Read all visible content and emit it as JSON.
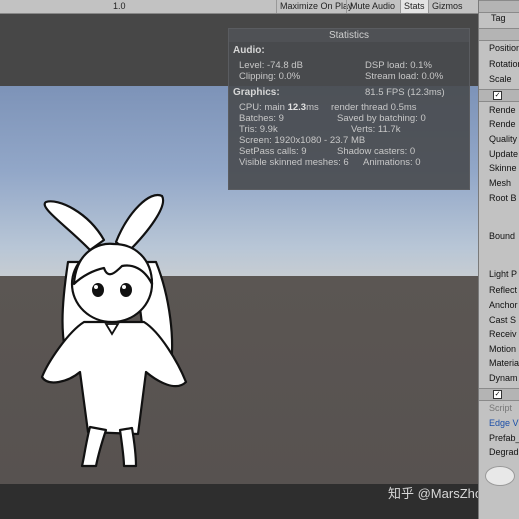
{
  "toolbar": {
    "items": [
      "1.0",
      "Maximize On Play",
      "Mute Audio",
      "Stats",
      "Gizmos"
    ]
  },
  "stats": {
    "title": "Statistics",
    "audio_label": "Audio:",
    "level": "Level: -74.8 dB",
    "clipping": "Clipping: 0.0%",
    "dsp_load": "DSP load: 0.1%",
    "stream_load": "Stream load: 0.0%",
    "graphics_label": "Graphics:",
    "fps": "81.5 FPS (12.3ms)",
    "cpu_prefix": "CPU: main",
    "cpu_main": "12.3",
    "cpu_suffix": "ms",
    "render_thread": "render thread 0.5ms",
    "batches": "Batches: 9",
    "saved_by_batching": "Saved by batching: 0",
    "tris": "Tris: 9.9k",
    "verts": "Verts: 11.7k",
    "screen": "Screen: 1920x1080 - 23.7 MB",
    "setpass": "SetPass calls: 9",
    "shadow_casters": "Shadow casters: 0",
    "skinned_meshes": "Visible skinned meshes: 6",
    "animations": "Animations: 0"
  },
  "inspector": {
    "tag": "Tag",
    "transform": [
      "Position",
      "Rotation",
      "Scale"
    ],
    "renderer": [
      "Rende",
      "Rende",
      "Quality",
      "Update",
      "Skinne",
      "Mesh",
      "Root B"
    ],
    "bounds": "Bound",
    "lighting": [
      "Light P",
      "Reflect",
      "Anchor",
      "Cast S",
      "Receiv",
      "Motion",
      "Materia",
      "Dynam"
    ],
    "script": [
      "Script",
      "Edge V",
      "Prefab_",
      "Degrad"
    ]
  },
  "watermark": "知乎 @MarsZhou",
  "colors": {
    "sky_top": "#7d93b8",
    "sky_horizon": "#c6ccd2",
    "ground": "#5b5653",
    "overlay": "#484a4e",
    "inspector_bg": "#c2c2c2",
    "link_blue": "#1c4fa8"
  }
}
